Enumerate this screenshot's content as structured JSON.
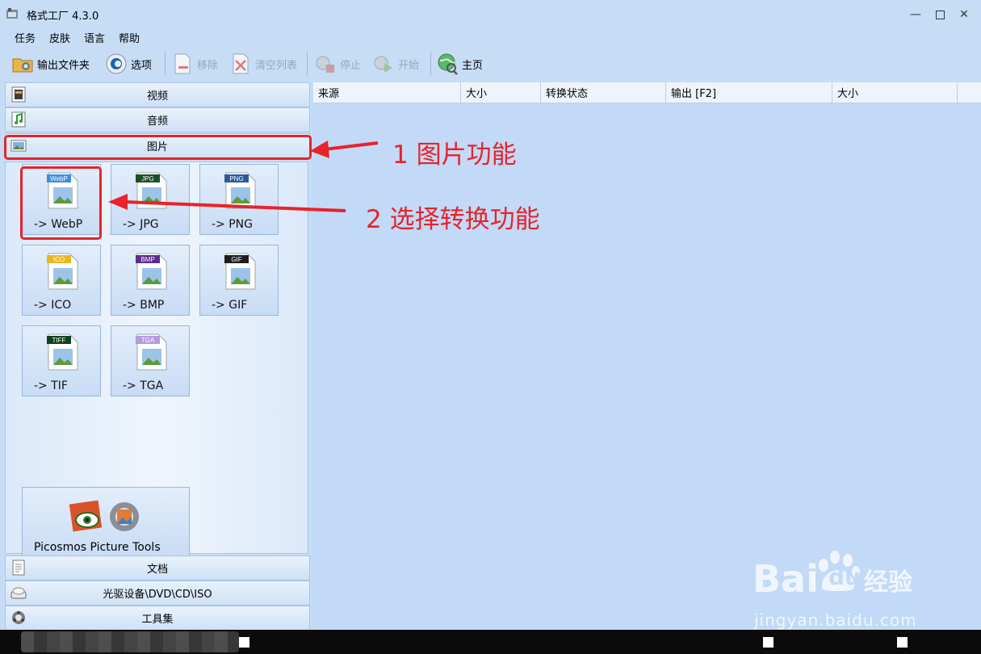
{
  "window": {
    "title": "格式工厂 4.3.0",
    "controls": [
      "minimize-icon",
      "maximize-icon",
      "close-icon"
    ]
  },
  "menu": [
    "任务",
    "皮肤",
    "语言",
    "帮助"
  ],
  "toolbar": {
    "output_folder": "输出文件夹",
    "options": "选项",
    "remove": "移除",
    "clear_list": "清空列表",
    "stop": "停止",
    "start": "开始",
    "home": "主页"
  },
  "categories": {
    "video": "视频",
    "audio": "音频",
    "image": "图片",
    "document": "文档",
    "optical": "光驱设备\\DVD\\CD\\ISO",
    "tools": "工具集"
  },
  "formats": [
    {
      "badge": "WebP",
      "label": "-> WebP",
      "color": "#3f8fd8"
    },
    {
      "badge": "JPG",
      "label": "-> JPG",
      "color": "#1d4f2a"
    },
    {
      "badge": "PNG",
      "label": "-> PNG",
      "color": "#2b5b9e"
    },
    {
      "badge": "ICO",
      "label": "-> ICO",
      "color": "#e6b820"
    },
    {
      "badge": "BMP",
      "label": "-> BMP",
      "color": "#5a2d8a"
    },
    {
      "badge": "GIF",
      "label": "-> GIF",
      "color": "#1e1e1e"
    },
    {
      "badge": "TIFF",
      "label": "-> TIF",
      "color": "#14401f"
    },
    {
      "badge": "TGA",
      "label": "-> TGA",
      "color": "#b39be0"
    }
  ],
  "picosmos": {
    "label": "Picosmos Picture Tools"
  },
  "list_columns": [
    "来源",
    "大小",
    "转换状态",
    "输出 [F2]",
    "大小"
  ],
  "annotations": {
    "step1": "1 图片功能",
    "step2": "2 选择转换功能",
    "color": "#e8232a"
  },
  "watermark": {
    "brand": "Bai",
    "brand2": "du",
    "cn": "经验",
    "url": "jingyan.baidu.com"
  }
}
